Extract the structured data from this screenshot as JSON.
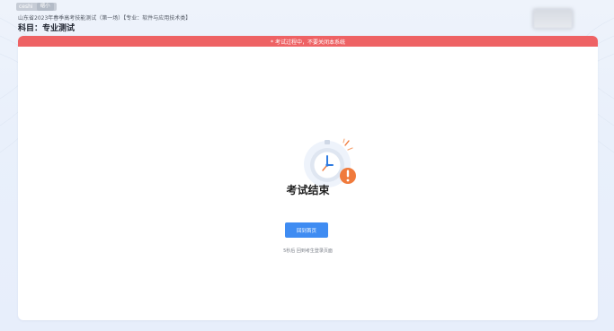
{
  "header": {
    "user_name": "ceshi",
    "minimize_label": "缩小",
    "exam_title": "山东省2023年春季高考技能测试（第一场）【专业：软件与应用技术类】",
    "subject": "科目：专业测试"
  },
  "warning": {
    "text": "* 考试过程中，不要关闭本系统"
  },
  "main": {
    "status_icon": "stopwatch-alert-icon",
    "finished_title": "考试结束",
    "home_button_label": "回到首页",
    "countdown_text": "5秒后 回到考生登录页面"
  },
  "colors": {
    "warning_bar": "#ee6264",
    "primary_button": "#3f8cf2",
    "alert_badge": "#f07a3c",
    "clock_hand": "#2f7be0"
  }
}
